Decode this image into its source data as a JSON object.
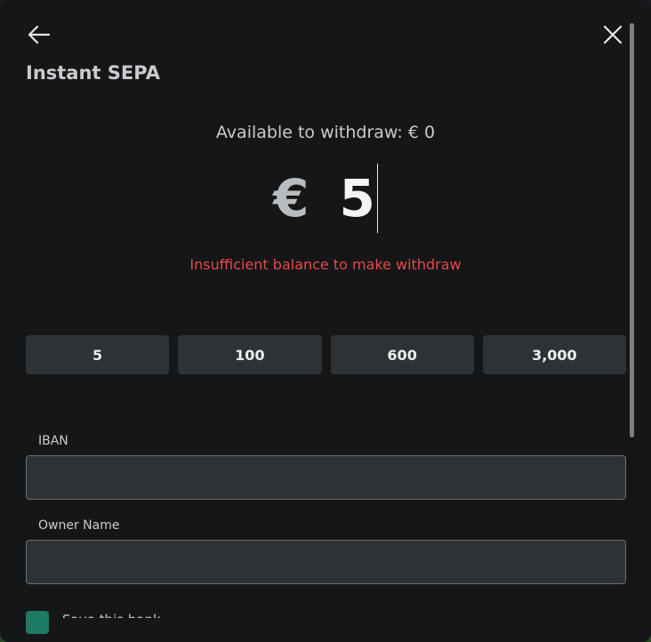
{
  "header": {
    "title": "Instant SEPA"
  },
  "balance": {
    "available_text": "Available to withdraw: € 0"
  },
  "amount": {
    "currency_symbol": "€",
    "value": "5"
  },
  "error": {
    "message": "Insufficient balance to make withdraw"
  },
  "presets": [
    "5",
    "100",
    "600",
    "3,000"
  ],
  "form": {
    "iban_label": "IBAN",
    "iban_value": "",
    "owner_label": "Owner Name",
    "owner_value": "",
    "checkbox_label": "Save this bank"
  },
  "colors": {
    "accent": "#1f7a64",
    "error": "#e8484a",
    "panel": "#141618",
    "button": "#2e3234"
  },
  "icons": {
    "back": "arrow-left-icon",
    "close": "close-icon"
  }
}
